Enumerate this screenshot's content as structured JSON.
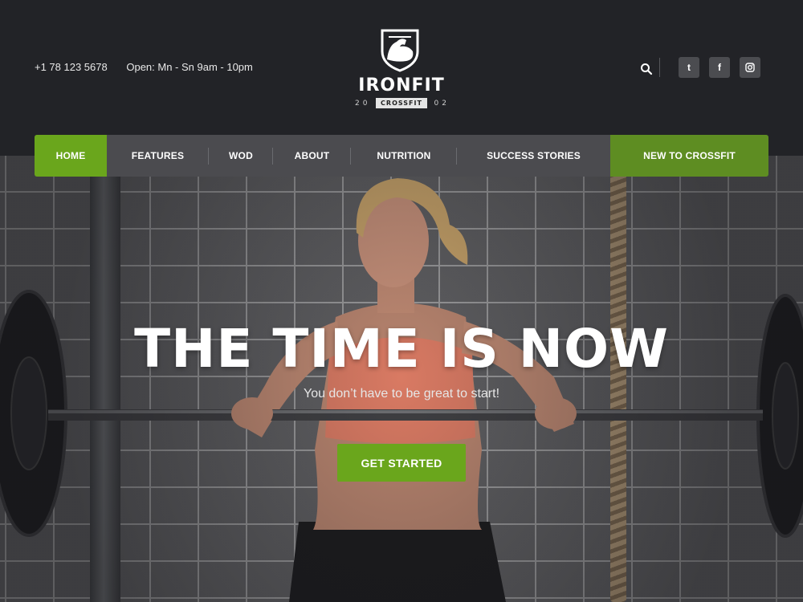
{
  "header": {
    "phone": "+1 78 123 5678",
    "hours": "Open: Mn - Sn 9am - 10pm",
    "logo": {
      "brand": "IRONFIT",
      "ribbon": "CROSSFIT",
      "year_left": "20",
      "year_right": "02"
    },
    "icons": {
      "search": "search-icon",
      "tumblr": "t",
      "facebook": "f",
      "instagram": "instagram-icon"
    }
  },
  "nav": {
    "items": [
      {
        "label": "HOME",
        "active": true
      },
      {
        "label": "FEATURES"
      },
      {
        "label": "WOD"
      },
      {
        "label": "ABOUT"
      },
      {
        "label": "NUTRITION"
      },
      {
        "label": "SUCCESS STORIES"
      }
    ],
    "cta_label": "NEW TO CROSSFIT"
  },
  "hero": {
    "title": "THE TIME IS NOW",
    "subtitle": "You don’t have to be great to start!",
    "button_label": "GET STARTED"
  },
  "colors": {
    "accent_green": "#6aa61c",
    "cta_green": "#5e8d22",
    "header_bg": "#222327",
    "nav_bg": "#4b4b4f"
  }
}
